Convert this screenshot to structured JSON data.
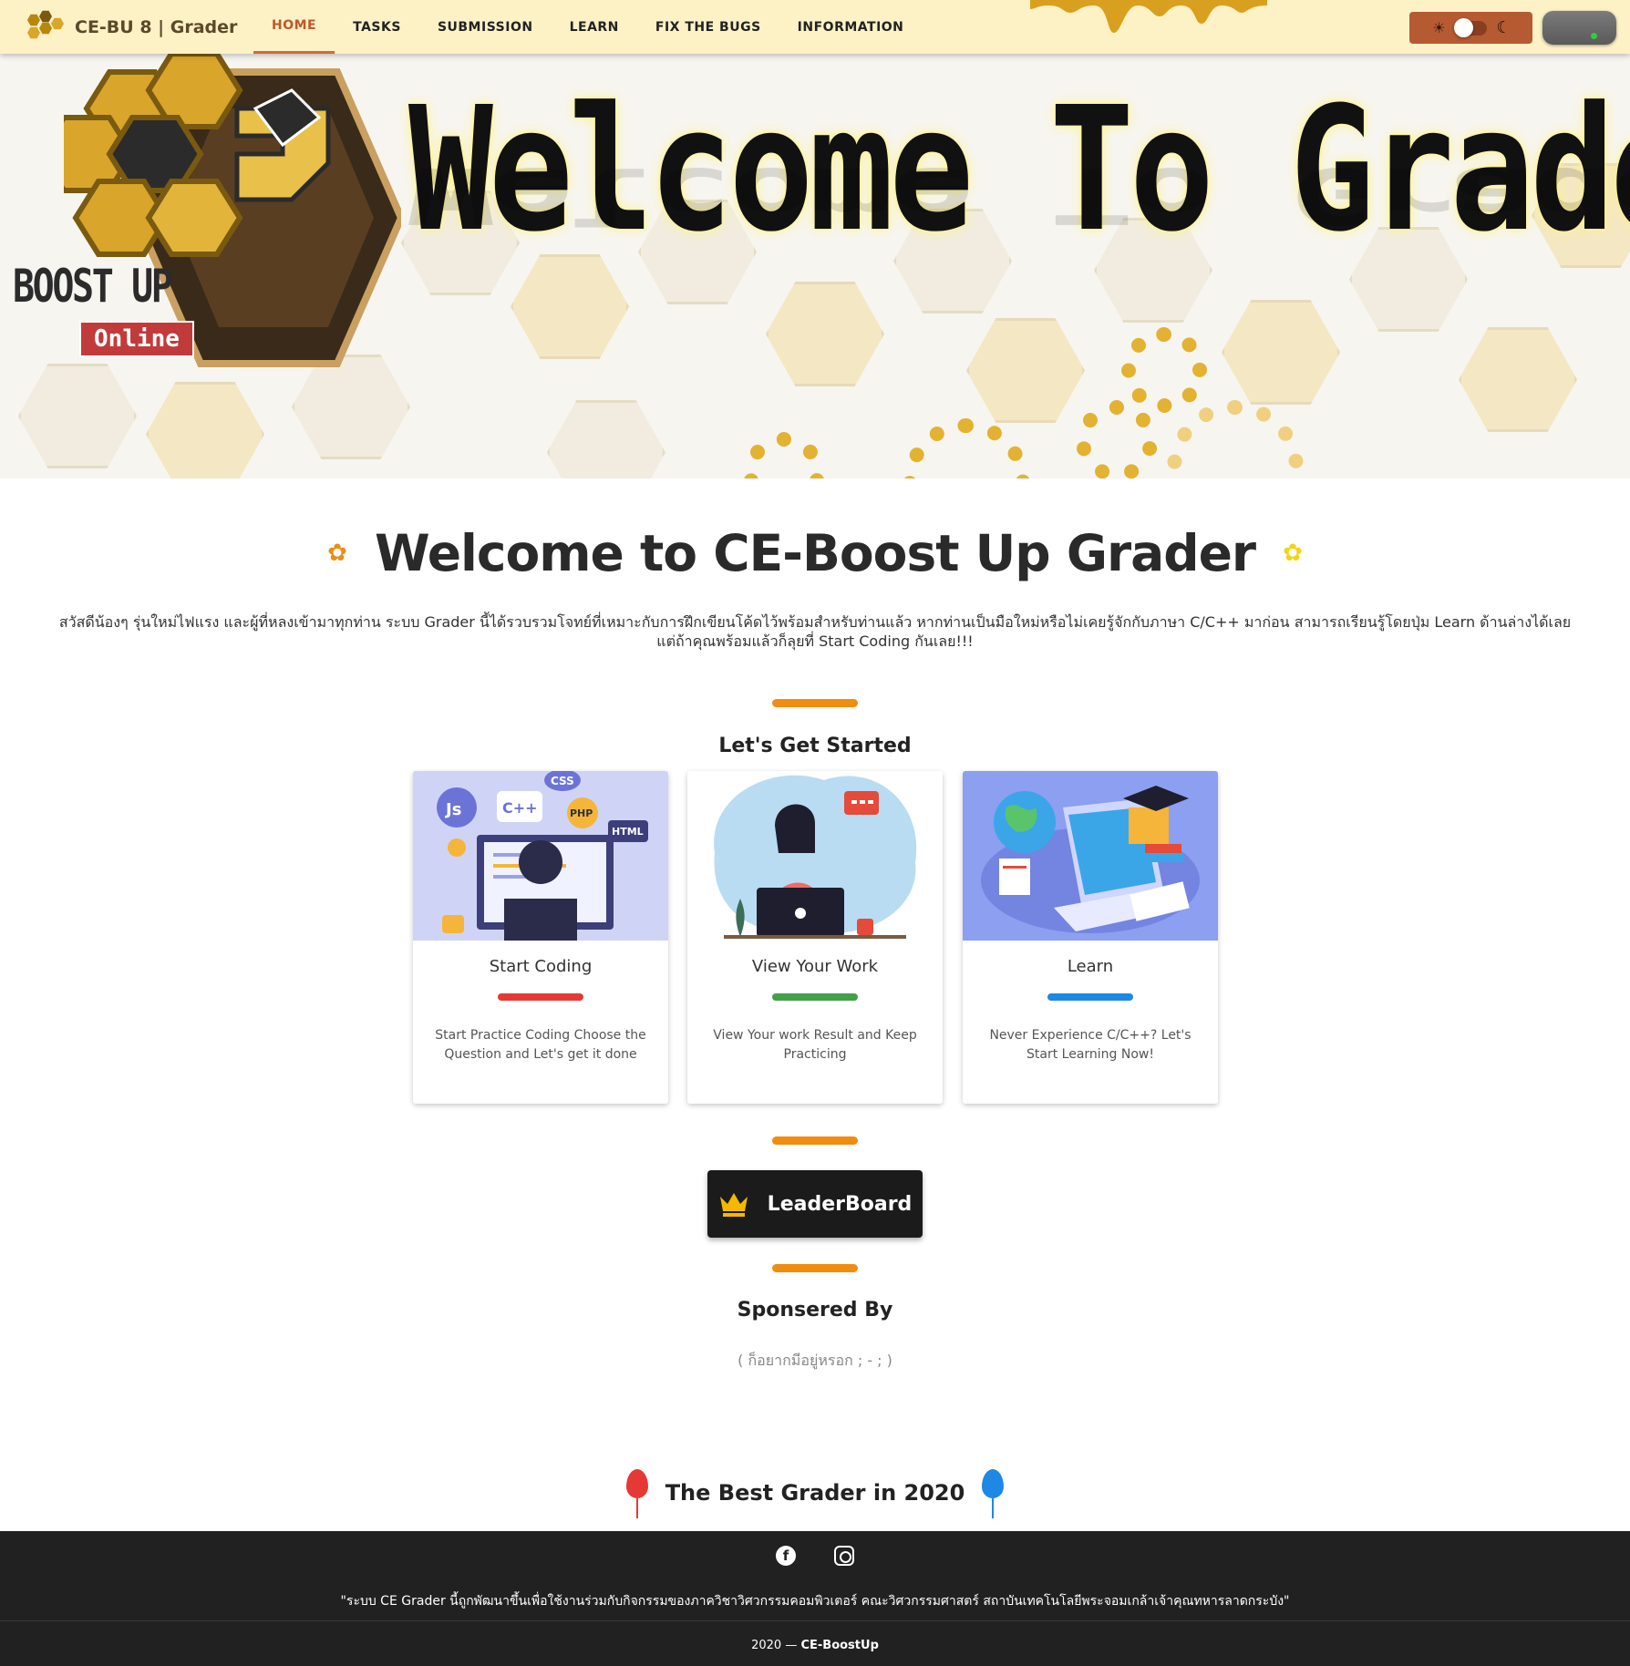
{
  "navbar": {
    "brand": "CE-BU 8 | Grader",
    "items": [
      {
        "label": "HOME",
        "active": true
      },
      {
        "label": "TASKS"
      },
      {
        "label": "SUBMISSION"
      },
      {
        "label": "LEARN"
      },
      {
        "label": "FIX THE BUGS"
      },
      {
        "label": "INFORMATION"
      }
    ],
    "theme_toggle": {
      "left_icon": "sun-icon",
      "right_icon": "moon-icon",
      "state": "light"
    }
  },
  "banner": {
    "title": "Welcome To Grader",
    "logo_text": "BOOST UP",
    "logo_badge": "Online"
  },
  "main": {
    "welcome_title": "Welcome to CE-Boost Up Grader",
    "intro": "สวัสดีน้องๆ รุ่นใหม่ไฟแรง และผู้ที่หลงเข้ามาทุกท่าน ระบบ Grader นี้ได้รวบรวมโจทย์ที่เหมาะกับการฝึกเขียนโค้ดไว้พร้อมสำหรับท่านแล้ว หากท่านเป็นมือใหม่หรือไม่เคยรู้จักกับภาษา C/C++ มาก่อน สามารถเรียนรู้โดยปุ่ม Learn ด้านล่างได้เลย แต่ถ้าคุณพร้อมแล้วก็ลุยที่ Start Coding กันเลย!!!",
    "get_started": "Let's Get Started",
    "cards": [
      {
        "title": "Start Coding",
        "desc": "Start Practice Coding Choose the Question and Let's get it done",
        "color": "#e53935",
        "image": "coding-illustration"
      },
      {
        "title": "View Your Work",
        "desc": "View Your work Result and Keep Practicing",
        "color": "#43a047",
        "image": "laptop-woman-illustration"
      },
      {
        "title": "Learn",
        "desc": "Never Experience C/C++? Let's Start Learning Now!",
        "color": "#1e88e5",
        "image": "online-learning-illustration"
      }
    ],
    "leaderboard_label": "LeaderBoard",
    "sponsored_title": "Sponsered By",
    "sponsored_sub": "( ก็อยากมีอยู่หรอก ; - ; )",
    "best_title": "The Best Grader in 2020"
  },
  "footer": {
    "note": "\"ระบบ CE Grader นี้ถูกพัฒนาขึ้นเพื่อใช้งานร่วมกับกิจกรรมของภาควิชาวิศวกรรมคอมพิวเตอร์ คณะวิศวกรรมศาสตร์ สถาบันเทคโนโลยีพระจอมเกล้าเจ้าคุณทหารลาดกระบัง\"",
    "year": "2020 — ",
    "org": "CE-BoostUp",
    "social": [
      "facebook-icon",
      "instagram-icon"
    ]
  },
  "colors": {
    "accent": "#f08c10",
    "navbar_bg": "#fdf1c6",
    "active_nav": "#c0582a",
    "footer_bg": "#212121"
  }
}
